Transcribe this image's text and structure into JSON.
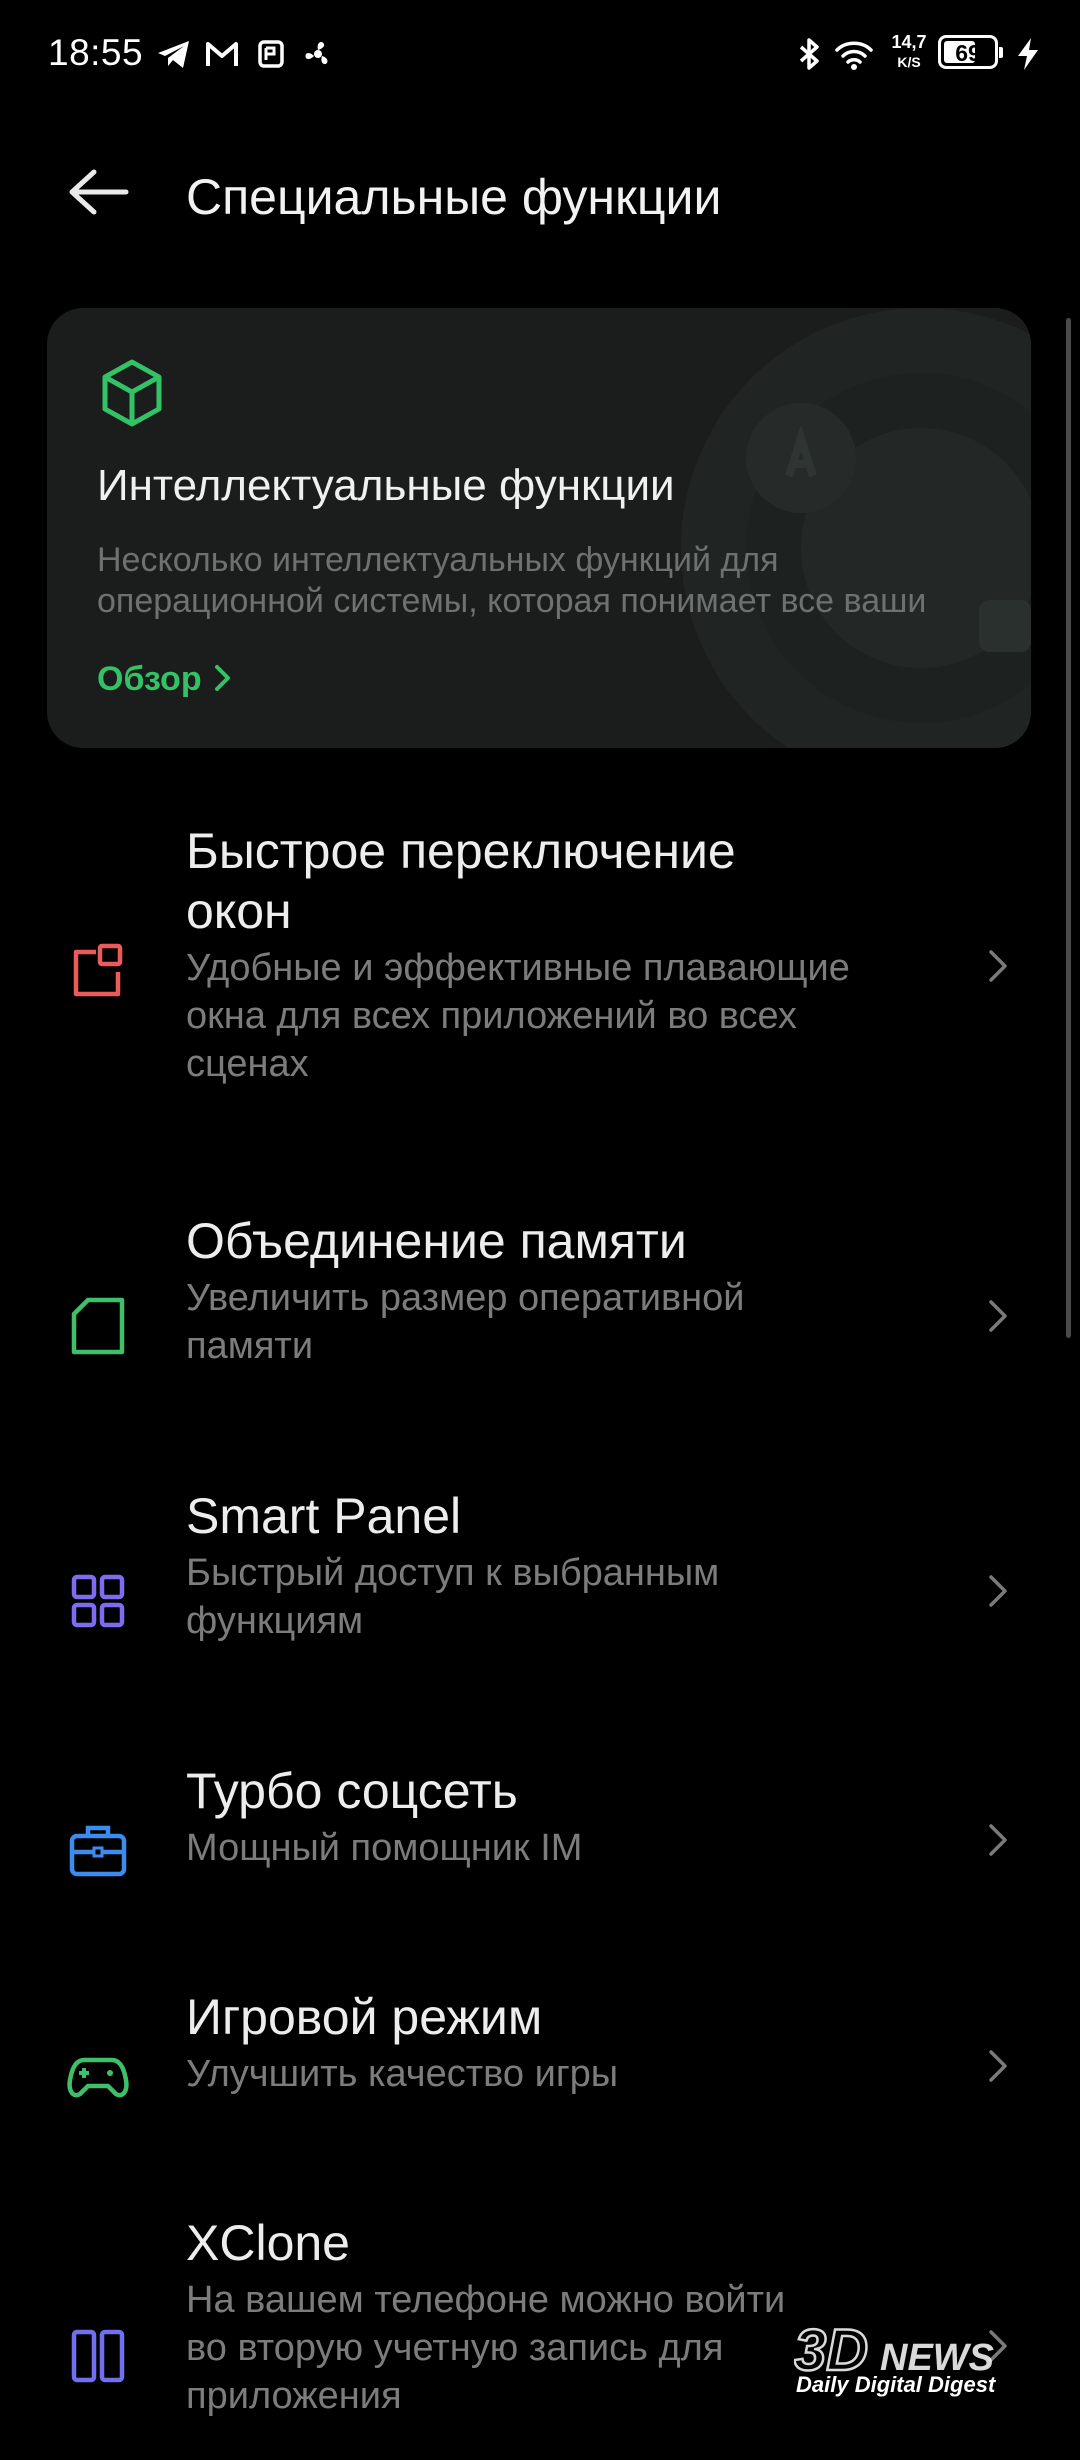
{
  "status_bar": {
    "time": "18:55",
    "speed_value": "14,7",
    "speed_unit": "K/S",
    "battery": "69",
    "battery_level_percent": 69,
    "icons": [
      "telegram-icon",
      "gmail-icon",
      "nfc-app-icon",
      "fan-icon",
      "bluetooth-icon",
      "wifi-icon",
      "battery-icon",
      "charging-icon"
    ]
  },
  "header": {
    "title": "Специальные функции"
  },
  "card": {
    "title": "Интеллектуальные функции",
    "desc_line1": "Несколько интеллектуальных функций для",
    "desc_line2": "операционной системы, которая понимает все ваши",
    "link": "Обзор",
    "accent": "#34c267"
  },
  "items": [
    {
      "title_line1": "Быстрое переключение",
      "title_line2": "окон",
      "sub_line1": "Удобные и эффективные плавающие",
      "sub_line2": "окна для всех приложений во всех",
      "sub_line3": "сценах",
      "icon": "floating-window-icon",
      "color": "#ec5b5b"
    },
    {
      "title": "Объединение памяти",
      "sub_line1": "Увеличить размер оперативной",
      "sub_line2": "памяти",
      "icon": "memory-card-icon",
      "color": "#3fbf6a"
    },
    {
      "title": "Smart Panel",
      "sub_line1": "Быстрый доступ к выбранным",
      "sub_line2": "функциям",
      "icon": "grid-panel-icon",
      "color": "#7d6cf0"
    },
    {
      "title": "Турбо соцсеть",
      "sub_line1": "Мощный помощник IM",
      "icon": "briefcase-icon",
      "color": "#3c8cf0"
    },
    {
      "title": "Игровой режим",
      "sub_line1": "Улучшить качество игры",
      "icon": "gamepad-icon",
      "color": "#3fbf6a"
    },
    {
      "title": "XClone",
      "sub_line1": "На вашем телефоне можно войти",
      "sub_line2": "во вторую учетную запись для",
      "sub_line3": "приложения",
      "icon": "dual-app-icon",
      "color": "#6f6ff0"
    }
  ],
  "watermark": {
    "brand": "3DNEWS",
    "tagline": "Daily Digital Digest"
  }
}
